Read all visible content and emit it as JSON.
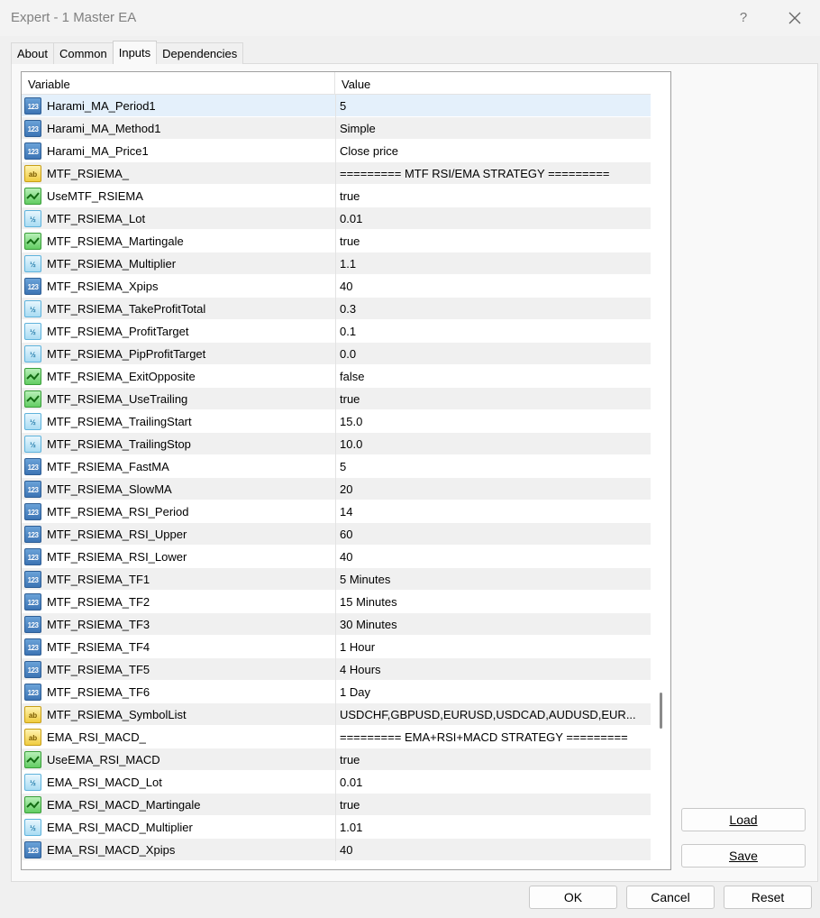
{
  "window": {
    "title": "Expert - 1 Master EA",
    "help_label": "?"
  },
  "tabs": [
    {
      "label": "About"
    },
    {
      "label": "Common"
    },
    {
      "label": "Inputs"
    },
    {
      "label": "Dependencies"
    }
  ],
  "active_tab": "Inputs",
  "grid": {
    "col_variable": "Variable",
    "col_value": "Value",
    "rows": [
      {
        "type": "int",
        "icon": "123",
        "name": "Harami_MA_Period1",
        "value": "5",
        "selected": true
      },
      {
        "type": "int",
        "icon": "123",
        "name": "Harami_MA_Method1",
        "value": "Simple"
      },
      {
        "type": "int",
        "icon": "123",
        "name": "Harami_MA_Price1",
        "value": "Close price"
      },
      {
        "type": "str",
        "icon": "ab",
        "name": "MTF_RSIEMA_",
        "value": "========= MTF RSI/EMA STRATEGY ========="
      },
      {
        "type": "bool",
        "icon": "bool",
        "name": "UseMTF_RSIEMA",
        "value": "true"
      },
      {
        "type": "dbl",
        "icon": "½",
        "name": "MTF_RSIEMA_Lot",
        "value": "0.01"
      },
      {
        "type": "bool",
        "icon": "bool",
        "name": "MTF_RSIEMA_Martingale",
        "value": "true"
      },
      {
        "type": "dbl",
        "icon": "½",
        "name": "MTF_RSIEMA_Multiplier",
        "value": "1.1"
      },
      {
        "type": "int",
        "icon": "123",
        "name": "MTF_RSIEMA_Xpips",
        "value": "40"
      },
      {
        "type": "dbl",
        "icon": "½",
        "name": "MTF_RSIEMA_TakeProfitTotal",
        "value": "0.3"
      },
      {
        "type": "dbl",
        "icon": "½",
        "name": "MTF_RSIEMA_ProfitTarget",
        "value": "0.1"
      },
      {
        "type": "dbl",
        "icon": "½",
        "name": "MTF_RSIEMA_PipProfitTarget",
        "value": "0.0"
      },
      {
        "type": "bool",
        "icon": "bool",
        "name": "MTF_RSIEMA_ExitOpposite",
        "value": "false"
      },
      {
        "type": "bool",
        "icon": "bool",
        "name": "MTF_RSIEMA_UseTrailing",
        "value": "true"
      },
      {
        "type": "dbl",
        "icon": "½",
        "name": "MTF_RSIEMA_TrailingStart",
        "value": "15.0"
      },
      {
        "type": "dbl",
        "icon": "½",
        "name": "MTF_RSIEMA_TrailingStop",
        "value": "10.0"
      },
      {
        "type": "int",
        "icon": "123",
        "name": "MTF_RSIEMA_FastMA",
        "value": "5"
      },
      {
        "type": "int",
        "icon": "123",
        "name": "MTF_RSIEMA_SlowMA",
        "value": "20"
      },
      {
        "type": "int",
        "icon": "123",
        "name": "MTF_RSIEMA_RSI_Period",
        "value": "14"
      },
      {
        "type": "int",
        "icon": "123",
        "name": "MTF_RSIEMA_RSI_Upper",
        "value": "60"
      },
      {
        "type": "int",
        "icon": "123",
        "name": "MTF_RSIEMA_RSI_Lower",
        "value": "40"
      },
      {
        "type": "int",
        "icon": "123",
        "name": "MTF_RSIEMA_TF1",
        "value": "5 Minutes"
      },
      {
        "type": "int",
        "icon": "123",
        "name": "MTF_RSIEMA_TF2",
        "value": "15 Minutes"
      },
      {
        "type": "int",
        "icon": "123",
        "name": "MTF_RSIEMA_TF3",
        "value": "30 Minutes"
      },
      {
        "type": "int",
        "icon": "123",
        "name": "MTF_RSIEMA_TF4",
        "value": "1 Hour"
      },
      {
        "type": "int",
        "icon": "123",
        "name": "MTF_RSIEMA_TF5",
        "value": "4 Hours"
      },
      {
        "type": "int",
        "icon": "123",
        "name": "MTF_RSIEMA_TF6",
        "value": "1 Day"
      },
      {
        "type": "str",
        "icon": "ab",
        "name": "MTF_RSIEMA_SymbolList",
        "value": "USDCHF,GBPUSD,EURUSD,USDCAD,AUDUSD,EUR..."
      },
      {
        "type": "str",
        "icon": "ab",
        "name": "EMA_RSI_MACD_",
        "value": "========= EMA+RSI+MACD STRATEGY ========="
      },
      {
        "type": "bool",
        "icon": "bool",
        "name": "UseEMA_RSI_MACD",
        "value": "true"
      },
      {
        "type": "dbl",
        "icon": "½",
        "name": "EMA_RSI_MACD_Lot",
        "value": "0.01"
      },
      {
        "type": "bool",
        "icon": "bool",
        "name": "EMA_RSI_MACD_Martingale",
        "value": "true"
      },
      {
        "type": "dbl",
        "icon": "½",
        "name": "EMA_RSI_MACD_Multiplier",
        "value": "1.01"
      },
      {
        "type": "int",
        "icon": "123",
        "name": "EMA_RSI_MACD_Xpips",
        "value": "40"
      }
    ]
  },
  "buttons": {
    "load": "Load",
    "save": "Save",
    "ok": "OK",
    "cancel": "Cancel",
    "reset": "Reset"
  },
  "colors": {
    "selected_row": "#e4f0fb",
    "alt_row": "#f0f0f0"
  }
}
